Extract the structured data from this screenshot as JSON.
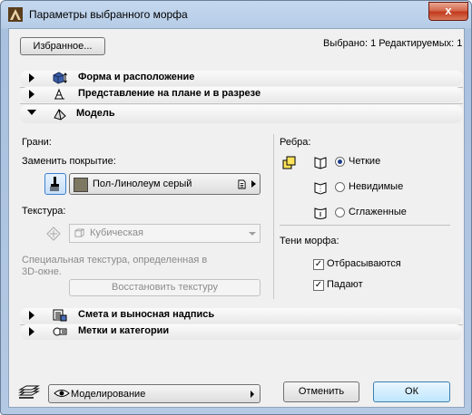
{
  "window": {
    "title": "Параметры выбранного морфа",
    "close_glyph": "x"
  },
  "header": {
    "favorites_label": "Избранное...",
    "selection_status": "Выбрано: 1 Редактируемых: 1"
  },
  "sections": [
    {
      "label": "Форма и расположение",
      "icon": "cube-move-icon",
      "expanded": false
    },
    {
      "label": "Представление на плане и в разрезе",
      "icon": "floor-plan-icon",
      "expanded": false
    },
    {
      "label": "Модель",
      "icon": "morph-model-icon",
      "expanded": true
    },
    {
      "label": "Смета и выносная надпись",
      "icon": "listing-icon",
      "expanded": false
    },
    {
      "label": "Метки и категории",
      "icon": "tags-icon",
      "expanded": false
    }
  ],
  "model": {
    "faces_label": "Грани:",
    "override_label": "Заменить покрытие:",
    "surface_value": "Пол-Линолеум серый",
    "surface_swatch_color": "#7d7862",
    "texture_label": "Текстура:",
    "texture_value": "Кубическая",
    "texture_note": "Специальная текстура, определенная в 3D-окне.",
    "restore_texture_label": "Восстановить текстуру",
    "edges_label": "Ребра:",
    "edge_options": [
      {
        "label": "Четкие",
        "selected": true
      },
      {
        "label": "Невидимые",
        "selected": false
      },
      {
        "label": "Сглаженные",
        "selected": false
      }
    ],
    "shadows_label": "Тени морфа:",
    "shadow_options": [
      {
        "label": "Отбрасываются",
        "checked": true
      },
      {
        "label": "Падают",
        "checked": true
      }
    ]
  },
  "footer": {
    "layer_value": "Моделирование",
    "cancel_label": "Отменить",
    "ok_label": "ОК"
  },
  "colors": {
    "accent": "#3b7fd1",
    "title_bar": "#b9cfe9",
    "close": "#c7432a"
  }
}
